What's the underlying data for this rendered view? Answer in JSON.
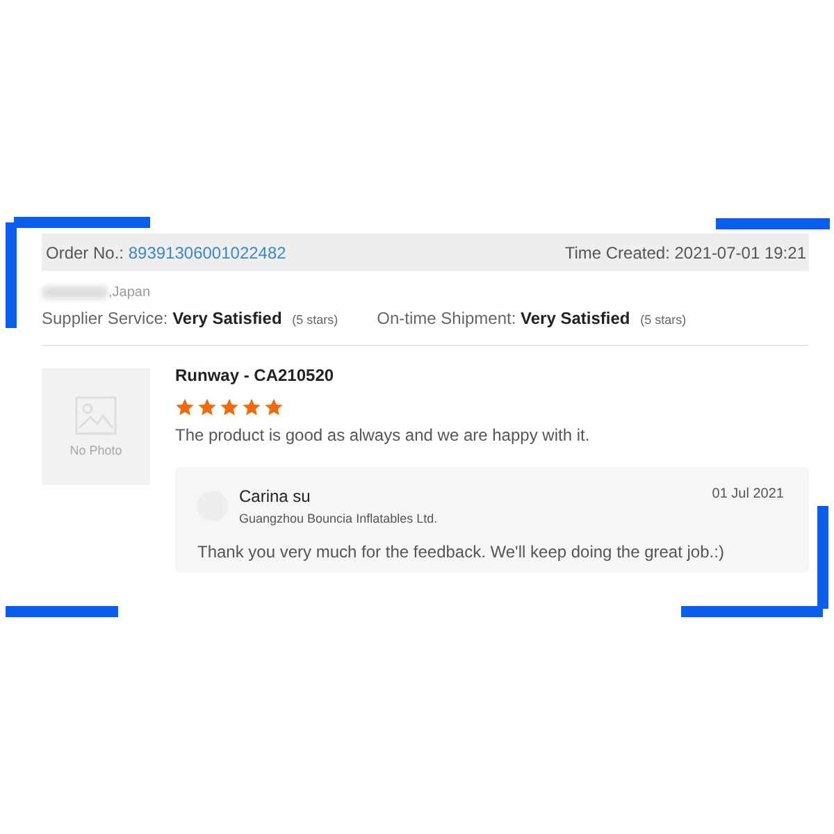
{
  "order": {
    "label": "Order No.:",
    "number": "89391306001022482",
    "time_created": "Time Created: 2021-07-01 19:21"
  },
  "buyer": {
    "location": ",Japan"
  },
  "ratings": [
    {
      "label": "Supplier Service:",
      "value": "Very Satisfied",
      "stars_text": "(5 stars)"
    },
    {
      "label": "On-time Shipment:",
      "value": "Very Satisfied",
      "stars_text": "(5 stars)"
    }
  ],
  "product": {
    "photo_placeholder": "No Photo",
    "name": "Runway - CA210520",
    "stars": 5,
    "comment": "The product is good as always and we are happy with it."
  },
  "reply": {
    "author": "Carina su",
    "company": "Guangzhou Bouncia Inflatables Ltd.",
    "date": "01 Jul 2021",
    "text": "Thank you very much for the feedback. We'll keep doing the great job.:)"
  }
}
